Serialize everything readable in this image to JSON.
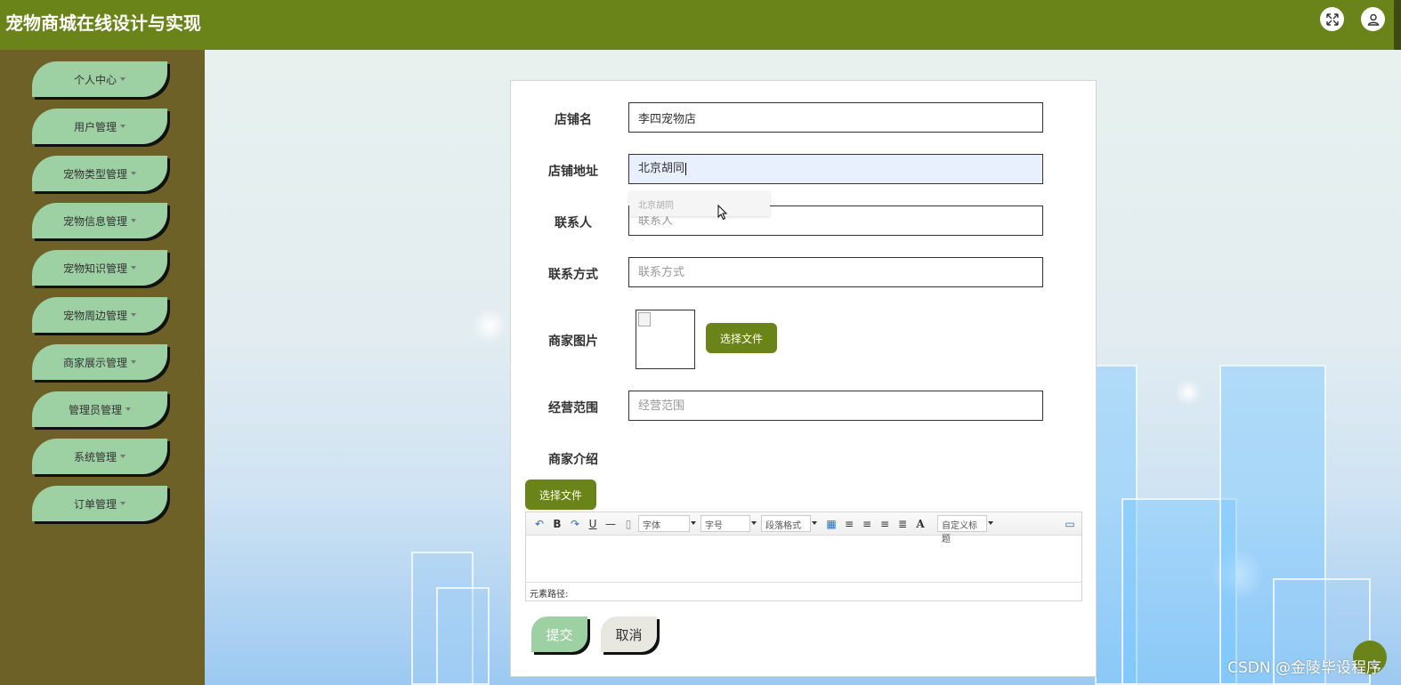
{
  "app": {
    "title": "宠物商城在线设计与实现"
  },
  "header": {
    "icons": [
      "fullscreen-icon",
      "user-icon"
    ]
  },
  "sidebar": {
    "items": [
      {
        "label": "个人中心"
      },
      {
        "label": "用户管理"
      },
      {
        "label": "宠物类型管理"
      },
      {
        "label": "宠物信息管理"
      },
      {
        "label": "宠物知识管理"
      },
      {
        "label": "宠物周边管理"
      },
      {
        "label": "商家展示管理"
      },
      {
        "label": "管理员管理"
      },
      {
        "label": "系统管理"
      },
      {
        "label": "订单管理"
      }
    ]
  },
  "form": {
    "shop_name": {
      "label": "店铺名",
      "value": "李四宠物店"
    },
    "shop_address": {
      "label": "店铺地址",
      "value": "北京胡同",
      "suggestion": "北京胡同"
    },
    "contact_person": {
      "label": "联系人",
      "placeholder": "联系人"
    },
    "contact_method": {
      "label": "联系方式",
      "placeholder": "联系方式"
    },
    "merchant_image": {
      "label": "商家图片",
      "button": "选择文件"
    },
    "business_scope": {
      "label": "经营范围",
      "placeholder": "经营范围"
    },
    "merchant_intro": {
      "label": "商家介绍",
      "button": "选择文件"
    }
  },
  "editor": {
    "font_select": "字体",
    "size_select": "字号",
    "paragraph_select": "段落格式",
    "font_color": "A",
    "custom_title_select": "自定义标题",
    "status": "元素路径:"
  },
  "actions": {
    "submit": "提交",
    "cancel": "取消"
  },
  "watermark": "CSDN @金陵毕设程序",
  "colors": {
    "header": "#6b841a",
    "sidebar": "#6d6127",
    "nav_item": "#9dd0a3",
    "button": "#6b841a"
  }
}
